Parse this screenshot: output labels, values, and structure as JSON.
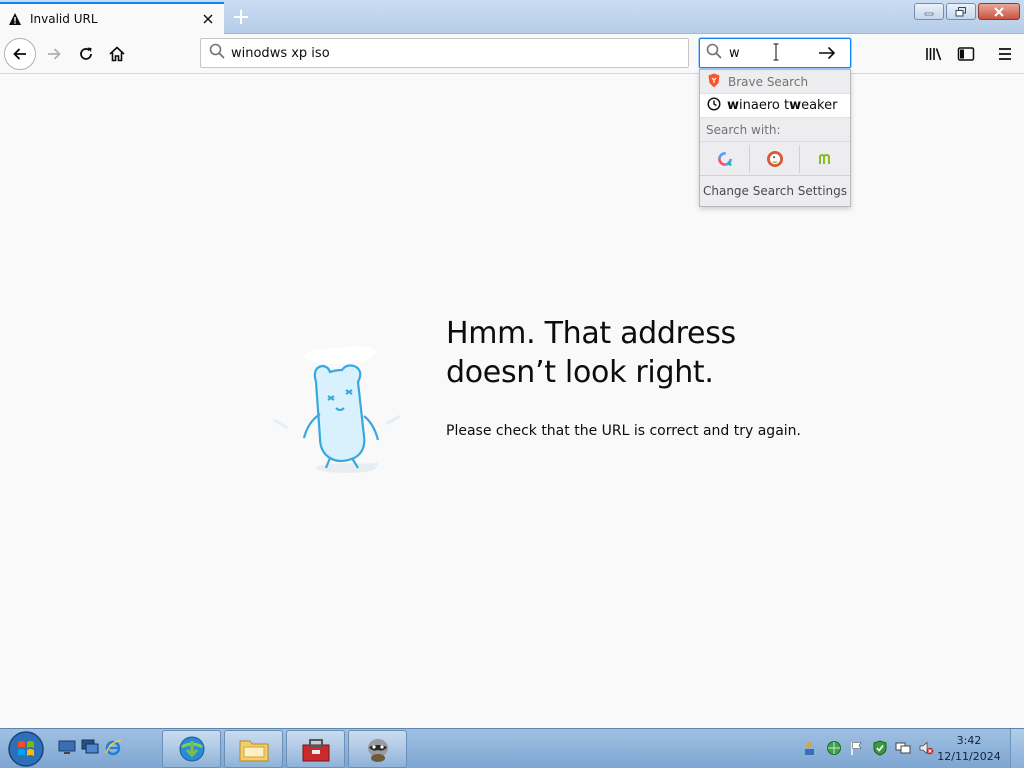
{
  "tab": {
    "title": "Invalid URL",
    "icon": "warning-icon"
  },
  "toolbar": {
    "url_value": "winodws xp iso",
    "search_value": "w"
  },
  "search_popup": {
    "engine": "Brave Search",
    "suggestion_bold_1": "w",
    "suggestion_mid": "inaero t",
    "suggestion_bold_2": "w",
    "suggestion_end": "eaker",
    "search_with": "Search with:",
    "engines": [
      "qwant-icon",
      "duckduckgo-icon",
      "mojeek-icon"
    ],
    "change_settings": "Change Search Settings"
  },
  "error": {
    "title_line1": "Hmm. That address",
    "title_line2": "doesn’t look right.",
    "description": "Please check that the URL is correct and try again."
  },
  "taskbar": {
    "time": "3:42",
    "date": "12/11/2024"
  },
  "colors": {
    "accent": "#0a84ff",
    "page_bg": "#f9f9fa",
    "taskbar": "#8fb3da"
  }
}
